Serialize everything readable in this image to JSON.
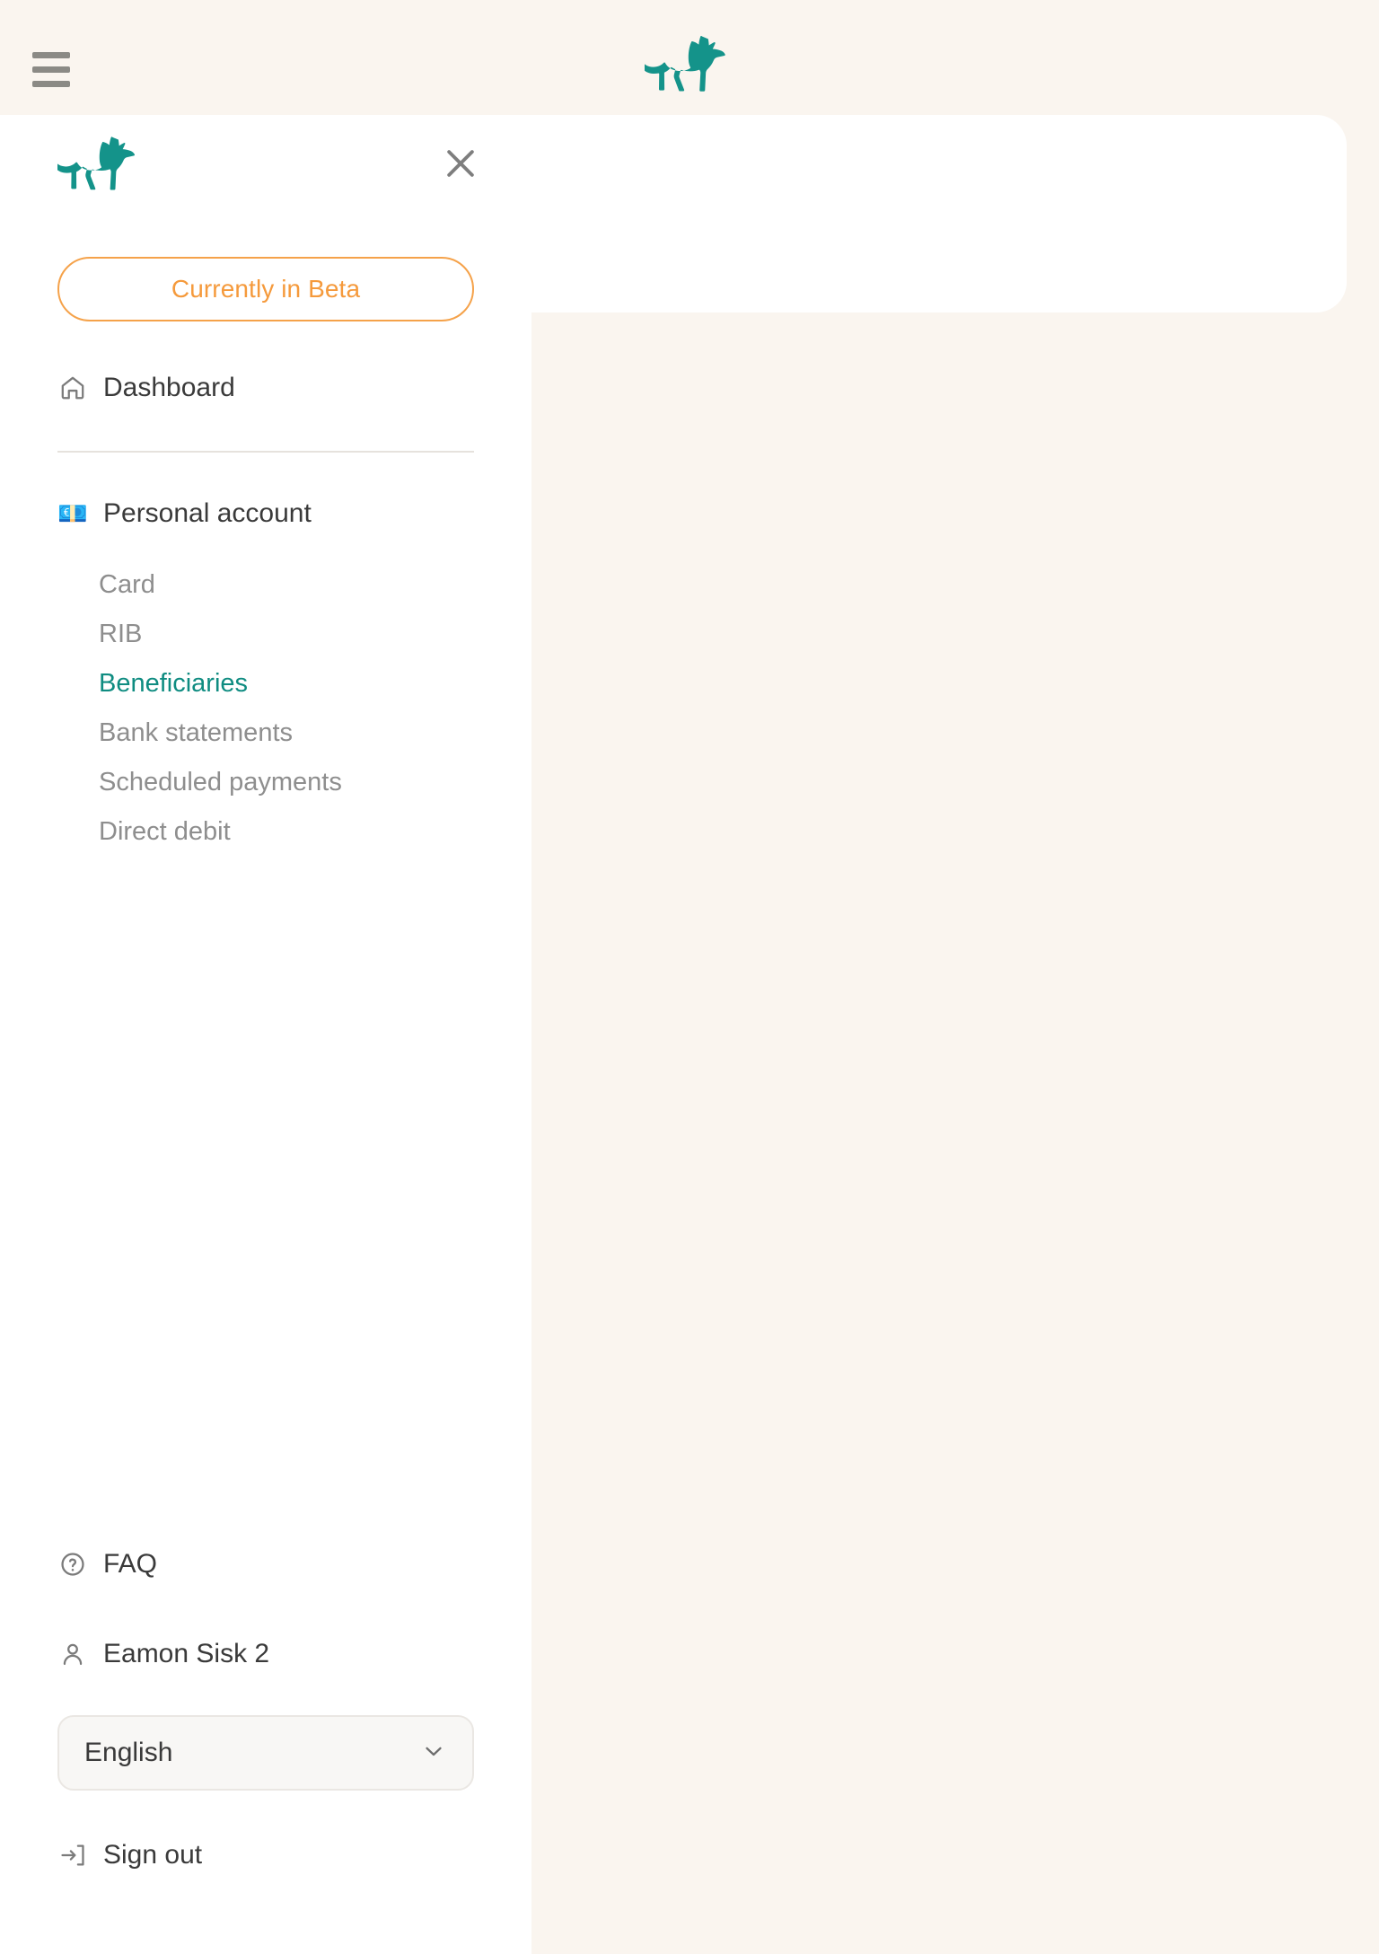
{
  "app": {
    "brand_logo": "dog-logo",
    "accent_teal": "#0f8c81",
    "accent_orange": "#f59a3c",
    "background": "#faf5ef",
    "surface": "#ffffff"
  },
  "appbar": {
    "menu_icon": "hamburger-menu-icon",
    "logo_icon": "brand-dog-logo"
  },
  "drawer": {
    "logo_icon": "brand-dog-logo",
    "close_icon": "close-x-icon",
    "beta_badge": "Currently in Beta",
    "primary": [
      {
        "label": "Dashboard",
        "icon": "home-icon",
        "active": false
      }
    ],
    "account": {
      "label": "Personal account",
      "icon": "euro-banknote-emoji",
      "emoji": "💶",
      "items": [
        {
          "label": "Card",
          "active": false
        },
        {
          "label": "RIB",
          "active": false
        },
        {
          "label": "Beneficiaries",
          "active": true
        },
        {
          "label": "Bank statements",
          "active": false
        },
        {
          "label": "Scheduled payments",
          "active": false
        },
        {
          "label": "Direct debit",
          "active": false
        }
      ]
    },
    "footer": {
      "faq": {
        "label": "FAQ",
        "icon": "question-circle-icon"
      },
      "user": {
        "label": "Eamon Sisk 2",
        "icon": "person-icon"
      },
      "language": {
        "selected": "English",
        "chevron_icon": "chevron-down-icon",
        "options": [
          "English"
        ]
      },
      "signout": {
        "label": "Sign out",
        "icon": "sign-out-icon"
      }
    }
  },
  "main": {
    "card_placeholder": ""
  }
}
